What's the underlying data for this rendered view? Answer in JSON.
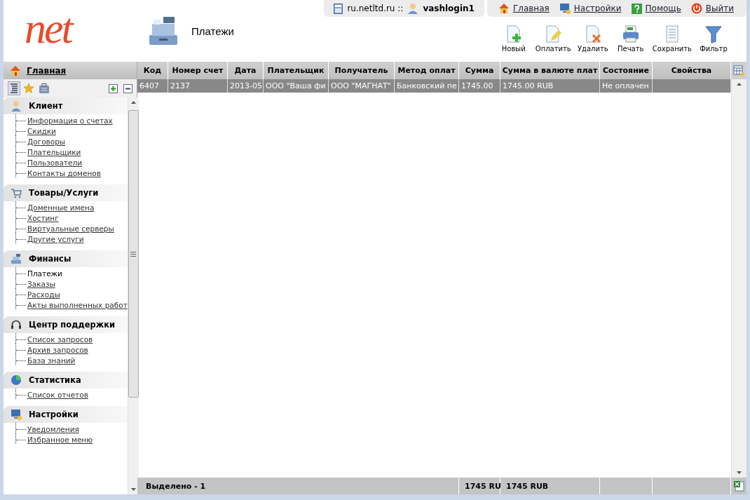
{
  "logo": "net",
  "top_bar": {
    "site": "ru.netltd.ru ::",
    "user": "vashlogin1",
    "links": [
      {
        "kind": "home",
        "label": "Главная"
      },
      {
        "kind": "settings",
        "label": "Настройки"
      },
      {
        "kind": "help",
        "label": "Помощь"
      },
      {
        "kind": "logout",
        "label": "Выйти"
      }
    ]
  },
  "page_title": "Платежи",
  "toolbar": [
    {
      "kind": "new",
      "label": "Новый"
    },
    {
      "kind": "pay",
      "label": "Оплатить"
    },
    {
      "kind": "delete",
      "label": "Удалить"
    },
    {
      "kind": "print",
      "label": "Печать"
    },
    {
      "kind": "save",
      "label": "Сохранить"
    },
    {
      "kind": "filter",
      "label": "Фильтр"
    }
  ],
  "sidebar": {
    "home": "Главная",
    "view_tabs": [
      {
        "kind": "tree",
        "selected": true
      },
      {
        "kind": "favorites",
        "selected": false
      },
      {
        "kind": "case",
        "selected": false
      }
    ],
    "sections": [
      {
        "kind": "client",
        "title": "Клиент",
        "items": [
          {
            "label": "Информация о счетах",
            "selected": false
          },
          {
            "label": "Скидки",
            "selected": false
          },
          {
            "label": "Договоры",
            "selected": false
          },
          {
            "label": "Плательщики",
            "selected": false
          },
          {
            "label": "Пользователи",
            "selected": false
          },
          {
            "label": "Контакты доменов",
            "selected": false
          }
        ]
      },
      {
        "kind": "cart",
        "title": "Товары/Услуги",
        "items": [
          {
            "label": "Доменные имена",
            "selected": false
          },
          {
            "label": "Хостинг",
            "selected": false
          },
          {
            "label": "Виртуальные серверы",
            "selected": false
          },
          {
            "label": "Другие услуги",
            "selected": false
          }
        ]
      },
      {
        "kind": "finance",
        "title": "Финансы",
        "items": [
          {
            "label": "Платежи",
            "selected": true
          },
          {
            "label": "Заказы",
            "selected": false
          },
          {
            "label": "Расходы",
            "selected": false
          },
          {
            "label": "Акты выполненных работ",
            "selected": false
          }
        ]
      },
      {
        "kind": "support",
        "title": "Центр поддержки",
        "items": [
          {
            "label": "Список запросов",
            "selected": false
          },
          {
            "label": "Архив запросов",
            "selected": false
          },
          {
            "label": "База знаний",
            "selected": false
          }
        ]
      },
      {
        "kind": "stats",
        "title": "Статистика",
        "items": [
          {
            "label": "Список отчетов",
            "selected": false
          }
        ]
      },
      {
        "kind": "settings",
        "title": "Настройки",
        "items": [
          {
            "label": "Уведомления",
            "selected": false
          },
          {
            "label": "Избранное меню",
            "selected": false
          }
        ]
      }
    ]
  },
  "table": {
    "columns": [
      "Код",
      "Номер счет",
      "Дата",
      "Плательщик",
      "Получатель",
      "Метод оплат",
      "Сумма",
      "Сумма в валюте плат",
      "Состояние",
      "Свойства"
    ],
    "rows": [
      {
        "selected": true,
        "cells": [
          "6407",
          "2137",
          "2013-05",
          "ООО \"Ваша фи",
          "ООО \"МАГНАТ\"",
          "Банковский пе",
          "1745.00",
          "1745.00 RUB",
          "Не оплачен",
          ""
        ]
      }
    ],
    "footer": {
      "label": "Выделено - 1",
      "totals": [
        "1745 RU",
        "1745 RUB"
      ]
    }
  }
}
